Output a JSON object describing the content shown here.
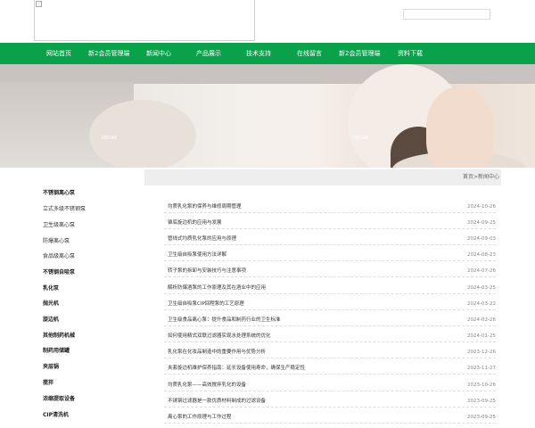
{
  "nav": {
    "items": [
      "网站首页",
      "新2会员管理端",
      "新闻中心",
      "产品展示",
      "技术支持",
      "在线留言",
      "新2会员管理端",
      "资料下载"
    ]
  },
  "banner": {
    "tags": [
      "DEDAE",
      "DEDAE"
    ]
  },
  "breadcrumb": "首页>新闻中心",
  "sidebar": {
    "items": [
      {
        "label": "不锈钢离心泵",
        "bold": true
      },
      {
        "label": "立式多级不锈钢泵",
        "bold": false
      },
      {
        "label": "卫生级离心泵",
        "bold": false
      },
      {
        "label": "防爆离心泵",
        "bold": false
      },
      {
        "label": "食品级离心泵",
        "bold": false
      },
      {
        "label": "不锈钢自吸泵",
        "bold": true
      },
      {
        "label": "乳化泵",
        "bold": true
      },
      {
        "label": "抛光机",
        "bold": true
      },
      {
        "label": "旋边机",
        "bold": true
      },
      {
        "label": "其他制药机械",
        "bold": true
      },
      {
        "label": "制药用储罐",
        "bold": true
      },
      {
        "label": "夹层锅",
        "bold": true
      },
      {
        "label": "搅拌",
        "bold": true
      },
      {
        "label": "浓缩提取设备",
        "bold": true
      },
      {
        "label": "CIP清洗机",
        "bold": true
      }
    ]
  },
  "news": [
    {
      "title": "均质乳化泵的保养与维修周期管理",
      "date": "2024-10-26"
    },
    {
      "title": "锥底旋边机的应用与发展",
      "date": "2024-09-25"
    },
    {
      "title": "管线式均质乳化泵的应用与原理",
      "date": "2024-09-03"
    },
    {
      "title": "卫生级自吸泵使用方法详解",
      "date": "2024-08-23"
    },
    {
      "title": "转子泵的拆卸与安装技巧与注意事项",
      "date": "2024-07-26"
    },
    {
      "title": "解析防爆酒泵的工作原理及其在酒业中的应用",
      "date": "2024-03-25"
    },
    {
      "title": "卫生级自吸泵CIP回程泵的工艺原理",
      "date": "2024-03-22"
    },
    {
      "title": "卫生级食品离心泵：提升食品和制药行业的卫生标准",
      "date": "2024-02-26"
    },
    {
      "title": "如何使用精式双联过滤器实现水处理系统的优化",
      "date": "2024-01-25"
    },
    {
      "title": "乳化泵在化妆品制造中的重要作用与优势分析",
      "date": "2023-12-26"
    },
    {
      "title": "夹套旋边机维护保养指南：延长设备使用寿命，确保生产稳定性",
      "date": "2023-11-27"
    },
    {
      "title": "均质乳化泵——高效搅拌乳化的设备",
      "date": "2023-10-26"
    },
    {
      "title": "不锈钢过滤器是一款优质材料制成的过滤设备",
      "date": "2023-09-25"
    },
    {
      "title": "离心泵的工作原理与工作过程",
      "date": "2023-09-25"
    }
  ],
  "colors": {
    "nav_bg": "#0aa14b",
    "crumb_bg": "#eeeeee"
  },
  "icons": [
    "broken-image-icon"
  ]
}
